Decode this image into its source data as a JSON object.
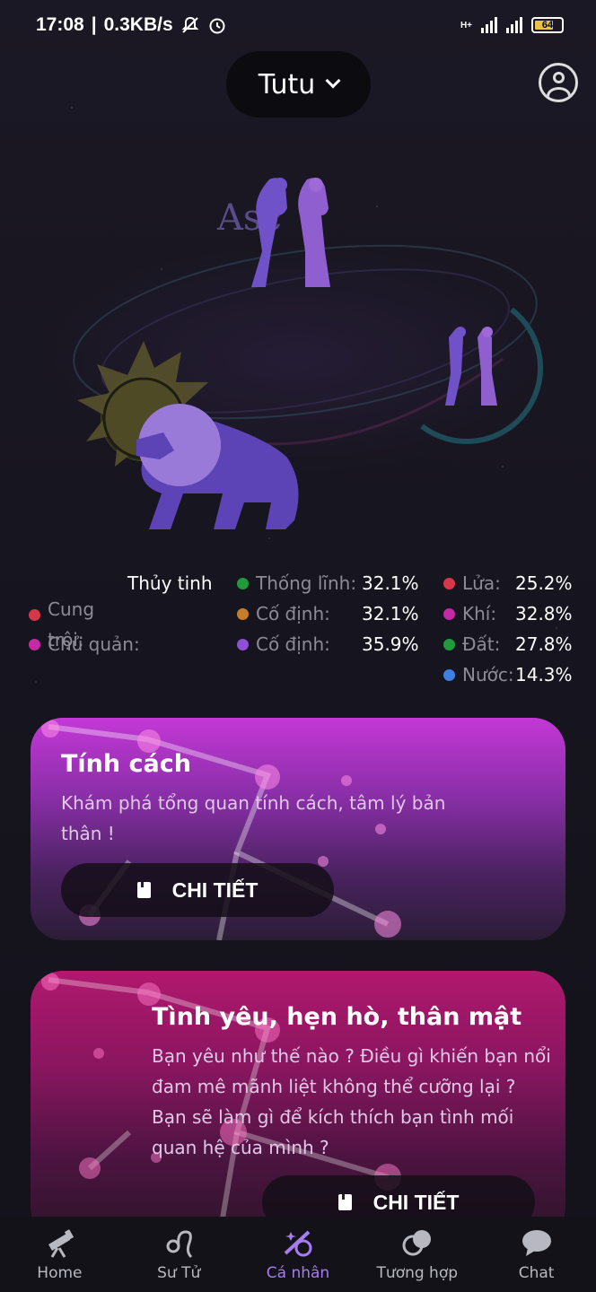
{
  "status_bar": {
    "time": "17:08",
    "net_speed": "0.3KB/s",
    "battery": "64",
    "network_type": "H+"
  },
  "header": {
    "profile_name": "Tutu"
  },
  "illustration": {
    "asc_label": "Asc"
  },
  "stats": {
    "col1": [
      {
        "label": "Cung trội:",
        "value": "Thủy tinh",
        "color": "#d6374a"
      },
      {
        "label": "Chủ quản:",
        "value": "",
        "color": "#c42aa6"
      }
    ],
    "col2": [
      {
        "label": "Thống lĩnh:",
        "value": "32.1%",
        "color": "#1f9a3c"
      },
      {
        "label": "Cố định:",
        "value": "32.1%",
        "color": "#c77c2a"
      },
      {
        "label": "Cố định:",
        "value": "35.9%",
        "color": "#8e4fd6"
      }
    ],
    "col3": [
      {
        "label": "Lửa:",
        "value": "25.2%",
        "color": "#d6374a"
      },
      {
        "label": "Khí:",
        "value": "32.8%",
        "color": "#c42aa6"
      },
      {
        "label": "Đất:",
        "value": "27.8%",
        "color": "#1f9a3c"
      },
      {
        "label": "Nước:",
        "value": "14.3%",
        "color": "#3f7fe0"
      }
    ]
  },
  "cards": [
    {
      "title": "Tính cách",
      "desc_line1": "Khám phá tổng quan tính cách, tâm lý bản",
      "desc_line2": "thân !",
      "button": "CHI TIẾT"
    },
    {
      "title": "Tình yêu, hẹn hò, thân mật",
      "desc_line1": "Bạn yêu như thế nào ? Điều gì khiến bạn nổi",
      "desc_line2": "đam mê mãnh liệt không thể cưỡng lại ?",
      "desc_line3": "Bạn sẽ làm gì để kích thích bạn tình mối",
      "desc_line4": "quan hệ của mình ?",
      "button": "CHI TIẾT"
    }
  ],
  "bottom_nav": [
    {
      "label": "Home",
      "icon": "telescope-icon"
    },
    {
      "label": "Sư Tử",
      "icon": "leo-icon"
    },
    {
      "label": "Cá nhân",
      "icon": "personal-stars-icon",
      "active": true
    },
    {
      "label": "Tương hợp",
      "icon": "compatibility-icon"
    },
    {
      "label": "Chat",
      "icon": "chat-icon"
    }
  ],
  "colors": {
    "background": "#15131c",
    "accent_active": "#a77bf2",
    "card1": "#c338d6",
    "card2": "#b0186e"
  }
}
